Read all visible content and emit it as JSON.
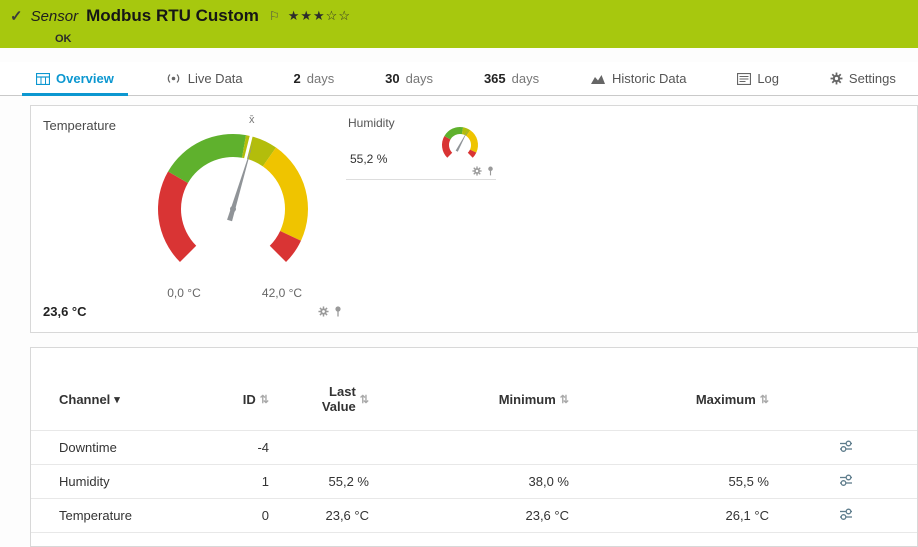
{
  "colors": {
    "header_green": "#a7c80e",
    "accent_blue": "#0c97d0",
    "gauge_red": "#d93434",
    "gauge_green": "#5fb12d",
    "gauge_olive": "#b3bd0b",
    "gauge_yellow": "#efc400",
    "needle_gray": "#909498"
  },
  "icons": {
    "check": "✓",
    "flag": "⚐",
    "sort": "⇅",
    "caret": "▾"
  },
  "header": {
    "kind_label": "Sensor",
    "title": "Modbus RTU Custom",
    "status": "OK",
    "rating_stars": "★★★☆☆"
  },
  "tabs": {
    "overview": "Overview",
    "live_data": "Live Data",
    "d2_num": "2",
    "d2_label": "days",
    "d30_num": "30",
    "d30_label": "days",
    "d365_num": "365",
    "d365_label": "days",
    "historic": "Historic Data",
    "log": "Log",
    "settings": "Settings"
  },
  "gauges": {
    "temperature": {
      "title": "Temperature",
      "value_label": "23,6 °C",
      "min_label": "0,0 °C",
      "max_label": "42,0 °C",
      "mean_marker": "x̄"
    },
    "humidity": {
      "title": "Humidity",
      "value_label": "55,2 %"
    }
  },
  "chart_data": [
    {
      "type": "gauge",
      "title": "Temperature",
      "unit": "°C",
      "min": 0,
      "max": 42,
      "value": 23.6,
      "value_label": "23,6 °C",
      "min_label": "0,0 °C",
      "max_label": "42,0 °C",
      "segment_colors": [
        "red",
        "green",
        "olive",
        "yellow",
        "red"
      ]
    },
    {
      "type": "gauge",
      "title": "Humidity",
      "unit": "%",
      "value": 55.2,
      "value_label": "55,2 %",
      "segment_colors": [
        "red",
        "green",
        "olive",
        "yellow",
        "red"
      ]
    }
  ],
  "table": {
    "headers": {
      "channel": "Channel",
      "id": "ID",
      "last_value": "Last Value",
      "minimum": "Minimum",
      "maximum": "Maximum"
    },
    "rows": [
      {
        "channel": "Downtime",
        "id": "-4",
        "last": "",
        "min": "",
        "max": ""
      },
      {
        "channel": "Humidity",
        "id": "1",
        "last": "55,2 %",
        "min": "38,0 %",
        "max": "55,5 %"
      },
      {
        "channel": "Temperature",
        "id": "0",
        "last": "23,6 °C",
        "min": "23,6 °C",
        "max": "26,1 °C"
      }
    ]
  }
}
